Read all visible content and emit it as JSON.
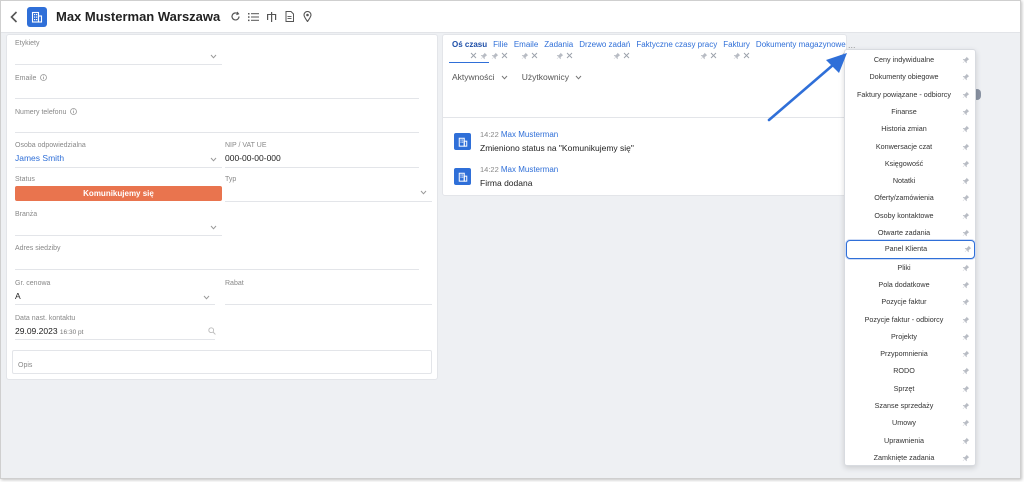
{
  "header": {
    "title": "Max Musterman Warszawa"
  },
  "form": {
    "etykiety_label": "Etykiety",
    "emaile_label": "Emaile",
    "numery_label": "Numery telefonu",
    "osoba_label": "Osoba odpowiedzialna",
    "osoba_value": "James Smith",
    "nip_label": "NIP / VAT UE",
    "nip_value": "000-00-00-000",
    "status_label": "Status",
    "status_value": "Komunikujemy się",
    "typ_label": "Typ",
    "branza_label": "Branża",
    "adres_label": "Adres siedziby",
    "gr_cenowa_label": "Gr. cenowa",
    "gr_cenowa_value": "A",
    "rabat_label": "Rabat",
    "data_label": "Data nast. kontaktu",
    "data_value": "29.09.2023",
    "data_time": "16:30 pt",
    "opis_label": "Opis"
  },
  "tabs": [
    {
      "label": "Oś czasu"
    },
    {
      "label": "Filie"
    },
    {
      "label": "Emaile"
    },
    {
      "label": "Zadania"
    },
    {
      "label": "Drzewo zadań"
    },
    {
      "label": "Faktyczne czasy pracy"
    },
    {
      "label": "Faktury"
    },
    {
      "label": "Dokumenty magazynowe"
    }
  ],
  "tabs_more": "...",
  "subnav": {
    "aktywnosci": "Aktywności",
    "uzytkownicy": "Użytkownicy"
  },
  "timeline": [
    {
      "time": "14:22",
      "author": "Max Musterman",
      "text": "Zmieniono status na \"Komunikujemy się\""
    },
    {
      "time": "14:22",
      "author": "Max Musterman",
      "text": "Firma dodana"
    }
  ],
  "dropdown": [
    "Ceny indywidualne",
    "Dokumenty obiegowe",
    "Faktury powiązane - odbiorcy",
    "Finanse",
    "Historia zmian",
    "Konwersacje czat",
    "Księgowość",
    "Notatki",
    "Oferty/zamówienia",
    "Osoby kontaktowe",
    "Otwarte zadania",
    "Panel Klienta",
    "Pliki",
    "Pola dodatkowe",
    "Pozycje faktur",
    "Pozycje faktur - odbiorcy",
    "Projekty",
    "Przypomnienia",
    "RODO",
    "Sprzęt",
    "Szanse sprzedaży",
    "Umowy",
    "Uprawnienia",
    "Zamknięte zadania"
  ],
  "colors": {
    "accent": "#2f6fd8",
    "status": "#e9744e"
  },
  "icons": {
    "back": "chevron-left-icon",
    "company": "building-icon",
    "refresh": "refresh-icon",
    "list": "list-icon",
    "tree": "tree-icon",
    "document": "document-icon",
    "location": "map-pin-icon",
    "pin": "pin-icon",
    "close": "close-icon"
  }
}
